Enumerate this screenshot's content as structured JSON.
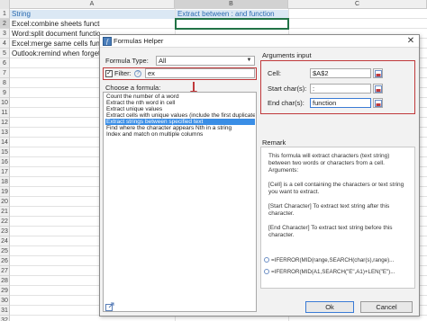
{
  "sheet": {
    "columns": [
      "A",
      "B",
      "C"
    ],
    "rows": [
      "1",
      "2",
      "3",
      "4",
      "5",
      "6",
      "7",
      "8",
      "9",
      "10",
      "11",
      "12",
      "13",
      "14",
      "15",
      "16",
      "17",
      "18",
      "19",
      "20",
      "21",
      "22",
      "23",
      "24",
      "25",
      "26",
      "27",
      "28",
      "29",
      "30",
      "31",
      "32"
    ],
    "header_a": "String",
    "header_b": "Extract between : and function",
    "cells_a": [
      "Excel:combine sheets function",
      "Word:split document function",
      "Excel:merge same cells functio",
      "Outlook:remind when forget a"
    ]
  },
  "dialog": {
    "title": "Formulas Helper",
    "formula_type_label": "Formula Type:",
    "formula_type_value": "All",
    "filter_label": "Filter:",
    "filter_checked": true,
    "filter_value": "ex",
    "choose_label": "Choose a formula:",
    "formulas": [
      "Count the number of a word",
      "Extract the nth word in cell",
      "Extract unique values",
      "Extract cells with unique values (include the first duplicate",
      "Extract strings between specified text",
      "Find where the character appears Nth in a string",
      "Index and match on multiple columns"
    ],
    "selected_formula": "Extract strings between specified text",
    "args_title": "Arguments input",
    "cell_label": "Cell:",
    "cell_value": "$A$2",
    "start_label": "Start char(s):",
    "start_value": ":",
    "end_label": "End char(s):",
    "end_value": "function",
    "remark_title": "Remark",
    "remark_lines": [
      "This formula will extract characters (text string)",
      "between two words or characters from a cell.",
      "Arguments:",
      "",
      "[Cell] is a cell containing the characters or text string",
      "you want to extract.",
      "",
      "[Start Character] To extract text string after this",
      "character.",
      "",
      "[End Character] To extract text string before this",
      "character."
    ],
    "example_1": "=IFERROR(MID(range,SEARCH(char(s),range)...",
    "example_2": "=IFERROR(MID(A1,SEARCH(\"E\",A1)+LEN(\"E\")...",
    "ok_label": "Ok",
    "cancel_label": "Cancel"
  },
  "colors": {
    "accent_red": "#c0393b",
    "selection_blue": "#3a8ee6",
    "header_fill": "#dbe8f4",
    "excel_green": "#217346"
  }
}
